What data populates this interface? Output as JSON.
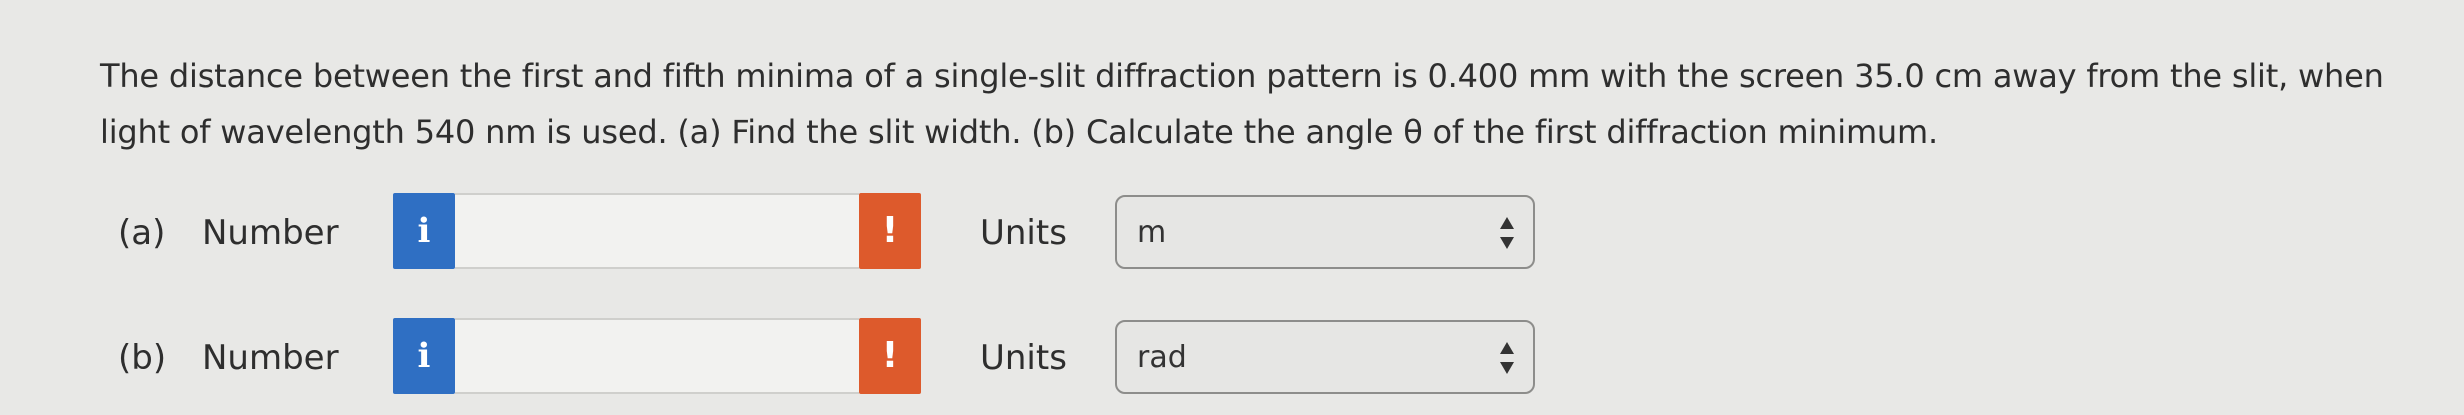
{
  "question": {
    "text": "The distance between the first and fifth minima of a single-slit diffraction pattern is 0.400 mm with the screen 35.0 cm away from the slit, when light of wavelength 540 nm is used. (a) Find the slit width. (b) Calculate the angle θ of the first diffraction minimum."
  },
  "parts": [
    {
      "label": "(a)",
      "number_label": "Number",
      "info_icon_text": "i",
      "answer_value": "",
      "warn_icon_text": "!",
      "units_label": "Units",
      "units_selected": "m"
    },
    {
      "label": "(b)",
      "number_label": "Number",
      "info_icon_text": "i",
      "answer_value": "",
      "warn_icon_text": "!",
      "units_label": "Units",
      "units_selected": "rad"
    }
  ],
  "colors": {
    "info_button": "#2f6fc3",
    "warning_button": "#dd5a2c",
    "background": "#e8e8e6"
  },
  "icons": {
    "info": "info-icon",
    "warning": "exclamation-icon",
    "select_arrows": "up-down-arrows-icon"
  }
}
